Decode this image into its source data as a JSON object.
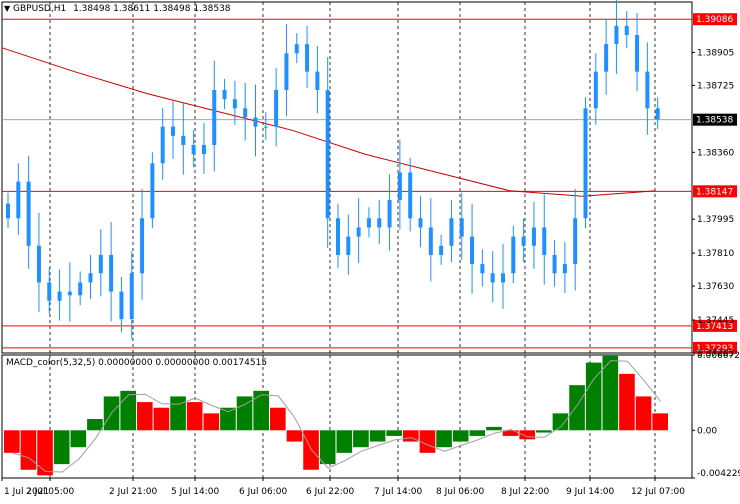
{
  "header": {
    "symbol": "GBPUSD,H1",
    "ohlc": "1.38498 1.38611 1.38498 1.38538",
    "dropdown_glyph": "▼"
  },
  "macd_header": {
    "label": "MACD_color(5,32,5) 0.00000000 0.00000000 0.00174515"
  },
  "price_axis": {
    "ticks": [
      "1.38905",
      "1.38725",
      "1.38360",
      "1.37995",
      "1.37810",
      "1.37630",
      "1.37445",
      "1.37265"
    ]
  },
  "price_markers": [
    {
      "label": "1.39086",
      "color": "#ff0000",
      "kind": "hline"
    },
    {
      "label": "1.38538",
      "color": "#000000",
      "kind": "current"
    },
    {
      "label": "1.38147",
      "color": "#ff0000",
      "kind": "hline"
    },
    {
      "label": "1.37413",
      "color": "#ff0000",
      "kind": "hline"
    },
    {
      "label": "1.37293",
      "color": "#ff0000",
      "kind": "hline"
    }
  ],
  "macd_axis": {
    "ticks": [
      "0.0066724",
      "0.00",
      "-0.004229"
    ]
  },
  "time_axis": {
    "labels": [
      "1 Jul 2021",
      "2 Jul 05:00",
      "2 Jul 21:00",
      "5 Jul 14:00",
      "6 Jul 06:00",
      "6 Jul 22:00",
      "7 Jul 14:00",
      "8 Jul 06:00",
      "8 Jul 22:00",
      "9 Jul 14:00",
      "12 Jul 07:00"
    ]
  },
  "colors": {
    "bull": "#1e90ff",
    "bear": "#1e90ff",
    "ma": "#cc0000",
    "level": "#ff0000",
    "macd_up": "#008000",
    "macd_down": "#ff0000",
    "signal": "#a0a0a0",
    "grid": "#000000"
  },
  "chart_data": [
    {
      "type": "line",
      "title": "GBPUSD,H1",
      "price_range": [
        1.37265,
        1.3918
      ],
      "series": [
        {
          "name": "GBPUSD,H1",
          "values": [
            1.38,
            1.382,
            1.3785,
            1.3765,
            1.3755,
            1.376,
            1.3758,
            1.3765,
            1.377,
            1.378,
            1.376,
            1.3745,
            1.377,
            1.38,
            1.383,
            1.385,
            1.3845,
            1.384,
            1.3835,
            1.384,
            1.387,
            1.3865,
            1.386,
            1.3855,
            1.385,
            1.385,
            1.387,
            1.389,
            1.3895,
            1.388,
            1.387,
            1.38,
            1.378,
            1.379,
            1.3795,
            1.38,
            1.3795,
            1.381,
            1.3825,
            1.38,
            1.3795,
            1.378,
            1.3785,
            1.38,
            1.379,
            1.3775,
            1.377,
            1.3765,
            1.377,
            1.379,
            1.3785,
            1.3795,
            1.378,
            1.377,
            1.3775,
            1.38,
            1.386,
            1.388,
            1.3895,
            1.3905,
            1.39,
            1.388,
            1.386,
            1.3854
          ]
        },
        {
          "name": "",
          "values": [
            1.3893,
            1.388,
            1.3868,
            1.3858,
            1.3848,
            1.3835,
            1.3825,
            1.3815,
            1.3812,
            1.3815
          ]
        }
      ]
    },
    {
      "type": "bar",
      "title": "MACD_color(5,32,5)",
      "y_range": [
        -0.004229,
        0.0066724
      ],
      "values": [
        -0.002,
        -0.0035,
        -0.004,
        -0.003,
        -0.0015,
        0.001,
        0.003,
        0.0035,
        0.0025,
        0.002,
        0.003,
        0.0025,
        0.0015,
        0.002,
        0.003,
        0.0035,
        0.002,
        -0.001,
        -0.0035,
        -0.003,
        -0.002,
        -0.0015,
        -0.001,
        -0.0005,
        -0.001,
        -0.002,
        -0.0015,
        -0.001,
        -0.0005,
        0.0003,
        -0.0005,
        -0.0008,
        -0.0002,
        0.0015,
        0.004,
        0.006,
        0.0066,
        0.005,
        0.003,
        0.0015
      ]
    }
  ]
}
